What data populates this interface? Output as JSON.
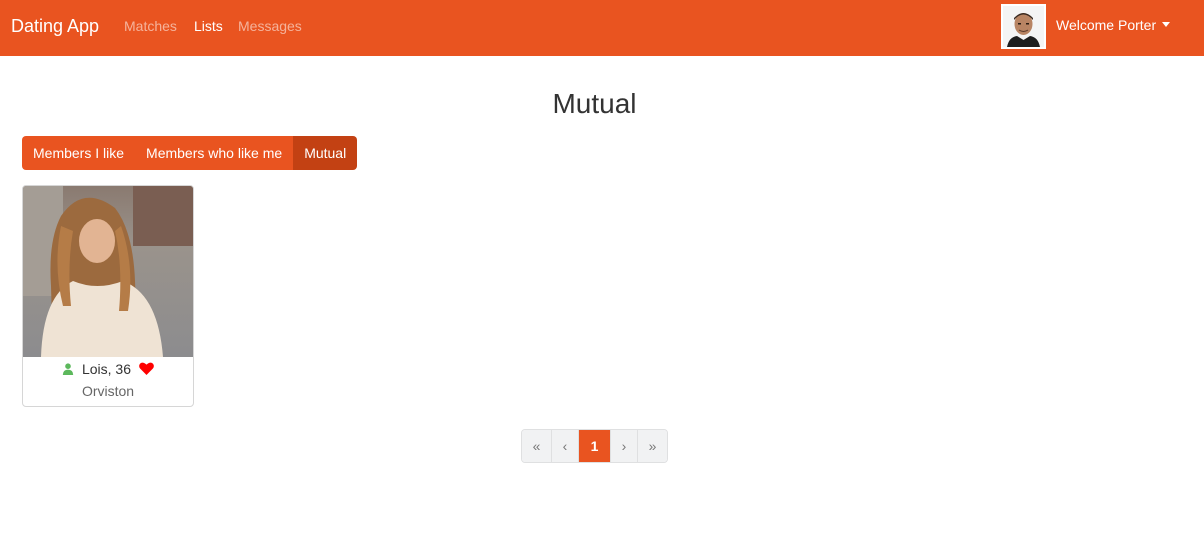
{
  "navbar": {
    "brand": "Dating App",
    "links": [
      {
        "label": "Matches",
        "active": false
      },
      {
        "label": "Lists",
        "active": true
      },
      {
        "label": "Messages",
        "active": false
      }
    ],
    "user": {
      "welcome": "Welcome Porter",
      "avatar_icon": "user-avatar"
    }
  },
  "page": {
    "title": "Mutual",
    "filters": [
      {
        "label": "Members I like",
        "active": false
      },
      {
        "label": "Members who like me",
        "active": false
      },
      {
        "label": "Mutual",
        "active": true
      }
    ]
  },
  "members": [
    {
      "name_age": "Lois, 36",
      "city": "Orviston",
      "online_icon": "user-icon",
      "like_icon": "heart-icon",
      "online_color": "#5cb85c",
      "like_color": "#ff0000"
    }
  ],
  "pagination": {
    "first": "«",
    "prev": "‹",
    "current": "1",
    "next": "›",
    "last": "»"
  },
  "colors": {
    "brand": "#E95420",
    "brand_active": "#C34113"
  }
}
